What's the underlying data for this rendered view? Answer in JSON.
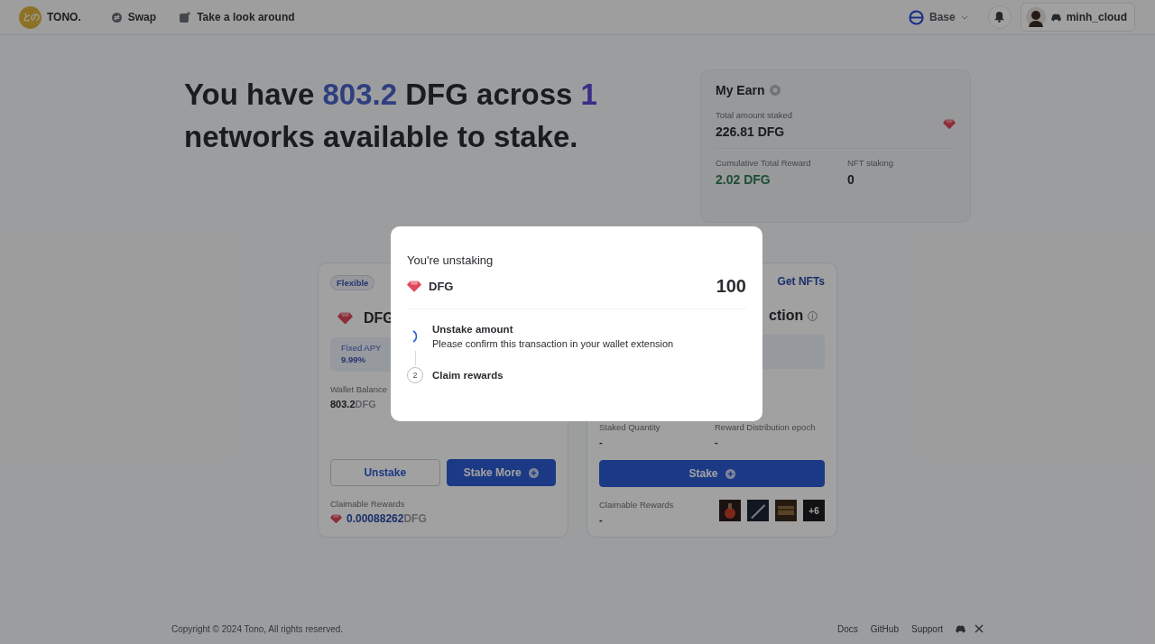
{
  "nav": {
    "logo_mark": "との",
    "brand": "TONO.",
    "links": [
      {
        "label": "Swap",
        "kind": "swap"
      },
      {
        "label": "Take a look around",
        "kind": "tour"
      }
    ],
    "network": "Base",
    "user": "minh_cloud"
  },
  "headline": {
    "parts": [
      {
        "text": "You have ",
        "kind": "plain"
      },
      {
        "text": "803.2",
        "kind": "amount"
      },
      {
        "text": " DFG across ",
        "kind": "plain"
      },
      {
        "text": "1",
        "kind": "count"
      },
      {
        "text": " networks available to stake.",
        "kind": "plain"
      }
    ]
  },
  "my_earn": {
    "title": "My Earn",
    "total_label": "Total amount staked",
    "total_value": "226.81 DFG",
    "reward_label": "Cumulative Total Reward",
    "reward_value": "2.02 DFG",
    "nft_label": "NFT staking",
    "nft_value": "0"
  },
  "flexible_card": {
    "badge": "Flexible",
    "token": "DFG",
    "apy_label": "Fixed APY",
    "apy_value": "9.99%",
    "balance_label": "Wallet Balance",
    "balance_value": "803.2",
    "balance_unit": "DFG",
    "buttons": [
      {
        "label": "Unstake",
        "kind": "outline"
      },
      {
        "label": "Stake More",
        "kind": "primary"
      }
    ],
    "claim_label": "Claimable Rewards",
    "claim_value": "0.00088262",
    "claim_unit": "DFG"
  },
  "nft_card": {
    "link": "Get NFTs",
    "title_visible": "ction",
    "stats": [
      {
        "label": "Staked Quantity",
        "value": "-"
      },
      {
        "label": "Reward Distribution epoch",
        "value": "-"
      }
    ],
    "button": "Stake",
    "claim_label": "Claimable Rewards",
    "claim_value": "-",
    "more": "+6"
  },
  "modal": {
    "title": "You're unstaking",
    "token": "DFG",
    "amount": "100",
    "steps": [
      {
        "active": true,
        "title": "Unstake amount",
        "description": "Please confirm this transaction in your wallet extension"
      },
      {
        "active": false,
        "number": "2",
        "title": "Claim rewards"
      }
    ]
  },
  "footer": {
    "copyright": "Copyright © 2024 Tono, All rights reserved.",
    "links": [
      "Docs",
      "GitHub",
      "Support"
    ]
  }
}
